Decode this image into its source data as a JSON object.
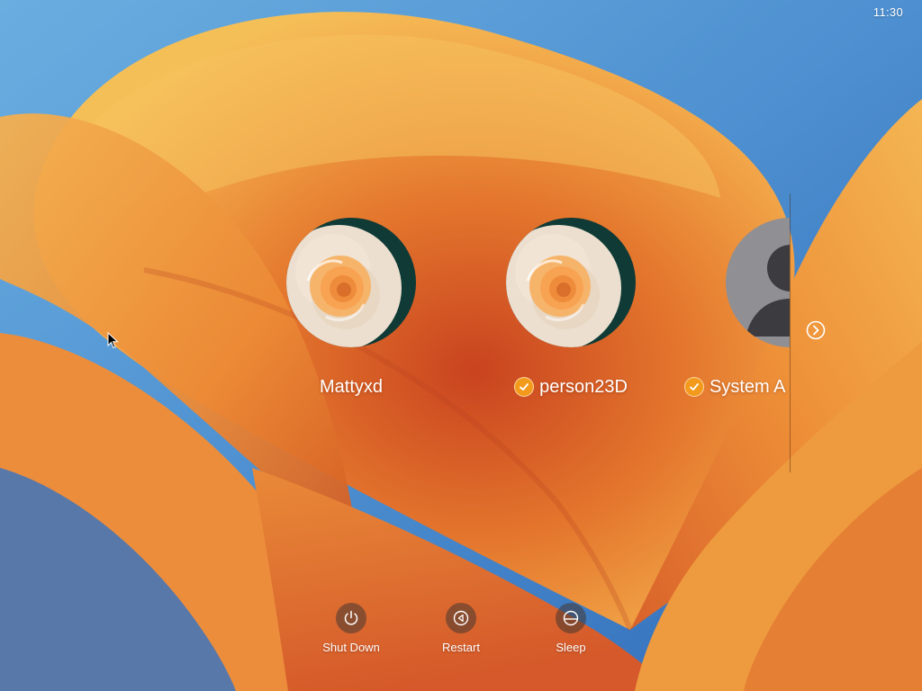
{
  "menu_bar": {
    "clock": "11:30"
  },
  "theme": {
    "accent": "#f39a1c",
    "text": "#ffffff",
    "power_button_bg": "#463732"
  },
  "users": [
    {
      "name": "Mattyxd",
      "avatar": "rose-avatar",
      "logged_in": false
    },
    {
      "name": "person23D",
      "avatar": "rose-avatar",
      "logged_in": true,
      "badge_icon": "checkmark-icon"
    },
    {
      "name": "System A",
      "avatar": "generic-user-avatar",
      "logged_in": true,
      "badge_icon": "checkmark-icon"
    }
  ],
  "navigation": {
    "next_icon": "chevron-right-circle-icon"
  },
  "power_actions": [
    {
      "label": "Shut Down",
      "icon": "power-icon"
    },
    {
      "label": "Restart",
      "icon": "restart-icon"
    },
    {
      "label": "Sleep",
      "icon": "sleep-icon"
    }
  ]
}
